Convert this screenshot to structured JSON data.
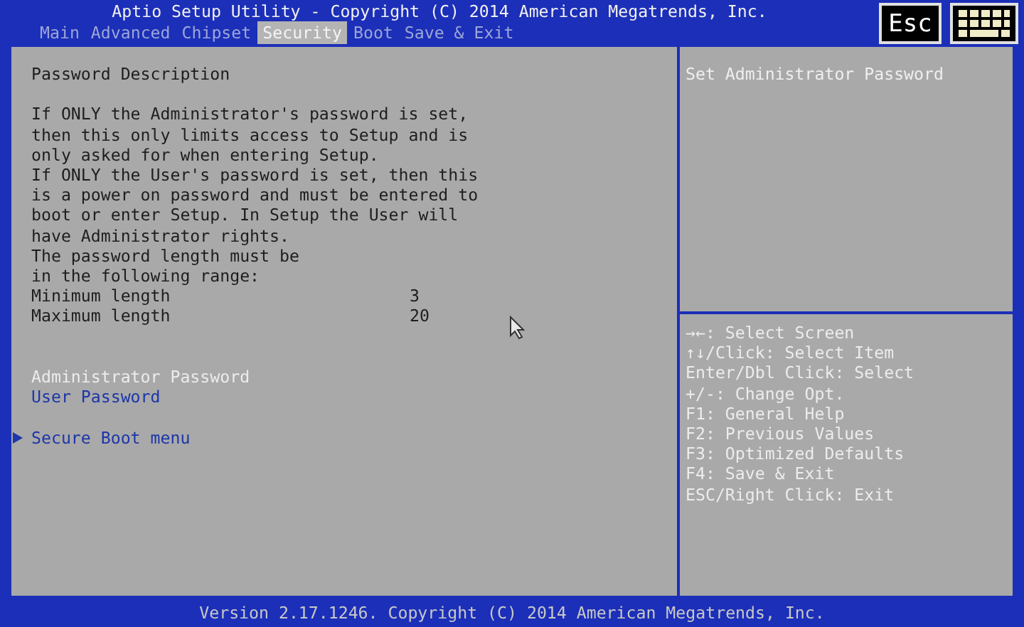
{
  "header": {
    "title": "Aptio Setup Utility - Copyright (C) 2014 American Megatrends, Inc.",
    "tabs": [
      {
        "label": "Main",
        "selected": false
      },
      {
        "label": "Advanced",
        "selected": false
      },
      {
        "label": "Chipset",
        "selected": false
      },
      {
        "label": "Security",
        "selected": true
      },
      {
        "label": "Boot",
        "selected": false
      },
      {
        "label": "Save & Exit",
        "selected": false
      }
    ],
    "esc_button": "Esc"
  },
  "description": {
    "title": "Password Description",
    "lines": [
      "If ONLY the Administrator's password is set,",
      "then this only limits access to Setup and is",
      "only asked for when entering Setup.",
      "If ONLY the User's password is set, then this",
      "is a power on password and must be entered to",
      "boot or enter Setup. In Setup the User will",
      "have Administrator rights.",
      "The password length must be",
      "in the following range:"
    ]
  },
  "ranges": [
    {
      "label": "Minimum length",
      "value": "3"
    },
    {
      "label": "Maximum length",
      "value": "20"
    }
  ],
  "items": [
    {
      "label": "Administrator Password",
      "kind": "option",
      "selected": true
    },
    {
      "label": "User Password",
      "kind": "option",
      "selected": false
    },
    {
      "label": "Secure Boot menu",
      "kind": "submenu",
      "selected": false
    }
  ],
  "help_text": "Set Administrator Password",
  "key_help": [
    "→←: Select Screen",
    "↑↓/Click: Select Item",
    "Enter/Dbl Click: Select",
    "+/-: Change Opt.",
    "F1: General Help",
    "F2: Previous Values",
    "F3: Optimized Defaults",
    "F4: Save & Exit",
    "ESC/Right Click: Exit"
  ],
  "footer": "Version 2.17.1246. Copyright (C) 2014 American Megatrends, Inc."
}
